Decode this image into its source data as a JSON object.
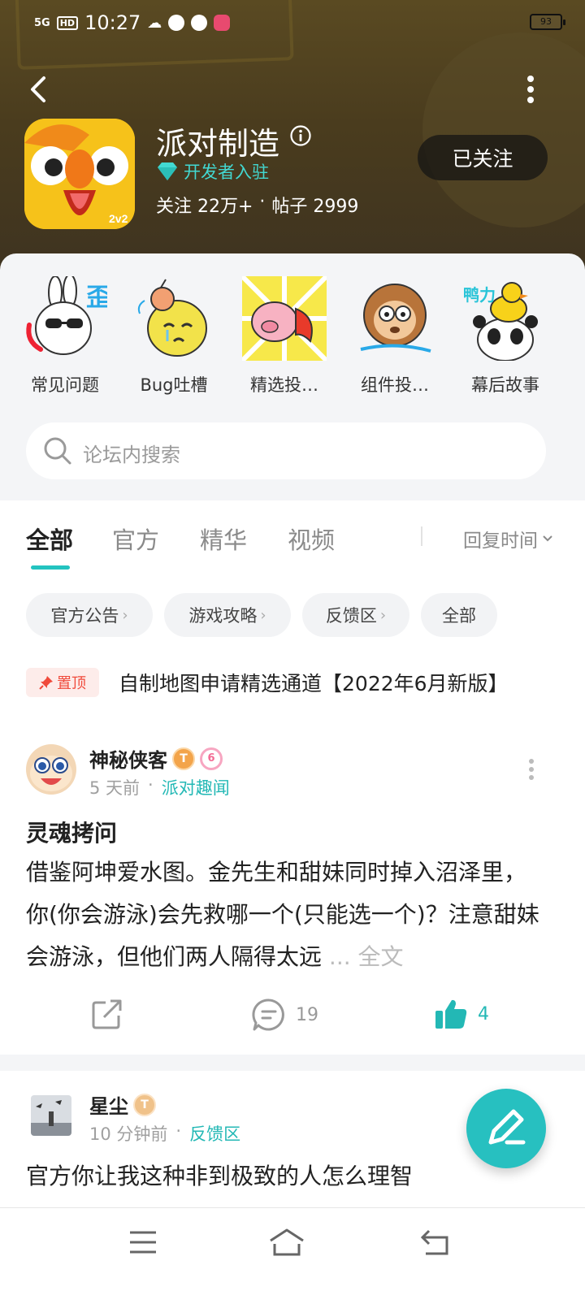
{
  "status": {
    "signal": "5G",
    "hd": "HD",
    "time": "10:27",
    "battery": "93"
  },
  "header": {
    "title": "派对制造",
    "developer_badge": "开发者入驻",
    "stats_follow": "关注 22万+",
    "stats_sep": "·",
    "stats_posts": "帖子 2999",
    "follow_button": "已关注",
    "app_icon_badge": "2v2"
  },
  "categories": [
    {
      "label": "常见问题",
      "sticker_text": "歪"
    },
    {
      "label": "Bug吐槽"
    },
    {
      "label": "精选投…"
    },
    {
      "label": "组件投…"
    },
    {
      "label": "幕后故事",
      "sticker_text": "鸭力"
    }
  ],
  "search": {
    "placeholder": "论坛内搜索"
  },
  "tabs": [
    {
      "label": "全部"
    },
    {
      "label": "官方"
    },
    {
      "label": "精华"
    },
    {
      "label": "视频"
    }
  ],
  "sort": {
    "label": "回复时间"
  },
  "chips": [
    {
      "label": "官方公告"
    },
    {
      "label": "游戏攻略"
    },
    {
      "label": "反馈区"
    },
    {
      "label": "全部"
    }
  ],
  "pinned": {
    "tag": "置顶",
    "title": "自制地图申请精选通道【2022年6月新版】"
  },
  "posts": [
    {
      "author": "神秘侠客",
      "level": "T",
      "badge": "6",
      "time": "5 天前",
      "section": "派对趣闻",
      "title": "灵魂拷问",
      "body": "借鉴阿坤爱水图。金先生和甜妹同时掉入沼泽里，你(你会游泳)会先救哪一个(只能选一个)？注意甜妹会游泳，但他们两人隔得太远",
      "more": "... 全文",
      "comments": "19",
      "likes": "4"
    },
    {
      "author": "星尘",
      "level": "T",
      "time": "10 分钟前",
      "section": "反馈区",
      "body": "官方你让我这种非到极致的人怎么理智"
    }
  ],
  "colors": {
    "accent": "#23c3c0",
    "header_bg": "#4a3c1e",
    "pin_red": "#f04a3b"
  }
}
